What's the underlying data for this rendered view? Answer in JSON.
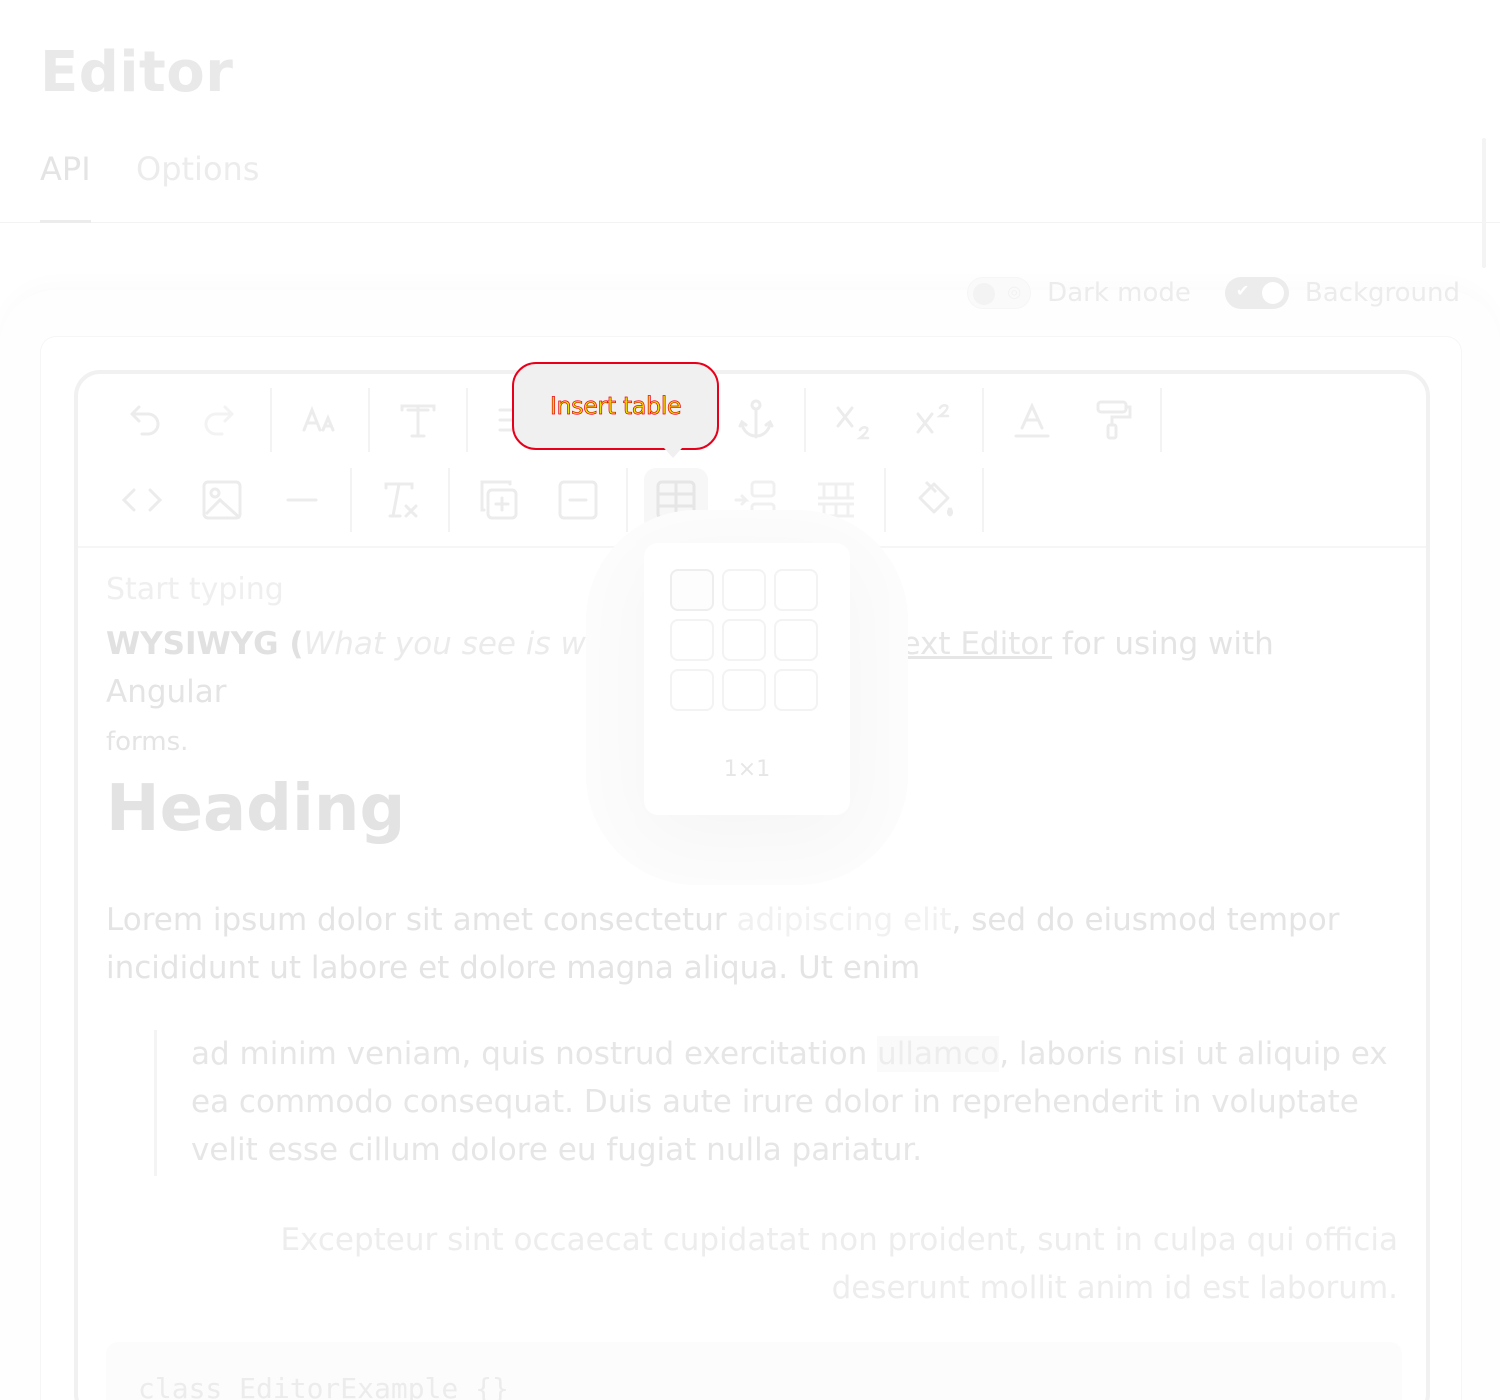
{
  "header": {
    "title": "Editor"
  },
  "tabs": [
    {
      "label": "API",
      "active": true
    },
    {
      "label": "Options",
      "active": false
    }
  ],
  "toggles": {
    "dark_mode": {
      "label": "Dark mode",
      "on": false
    },
    "background": {
      "label": "Background",
      "on": true
    }
  },
  "toolbar": {
    "row1": [
      "undo-icon",
      "redo-icon",
      "font-size-icon",
      "text-style-icon",
      "align-icon",
      "link-icon",
      "anchor-icon",
      "subscript-icon",
      "superscript-icon",
      "text-color-icon",
      "paint-roller-icon"
    ],
    "row2": [
      "code-icon",
      "image-icon",
      "horizontal-rule-icon",
      "clear-format-icon",
      "merge-cells-icon",
      "remove-cells-icon",
      "insert-table-icon",
      "insert-row-icon",
      "insert-column-icon",
      "cell-color-icon"
    ],
    "tooltip": "Insert table"
  },
  "table_picker": {
    "size_label": "1×1",
    "rows": 3,
    "cols": 3,
    "selected_rows": 1,
    "selected_cols": 1
  },
  "content": {
    "placeholder": "Start typing",
    "intro_bold": "WYSIWYG",
    "intro_open": " (",
    "intro_italic": "What you see is what yo",
    "intro_link": "Text Editor",
    "intro_rest": " for using with Angular",
    "intro_tail": "forms.",
    "heading": "Heading",
    "para_start": "Lorem ipsum dolor sit amet consectetur ",
    "para_highlight": "adipiscing elit",
    "para_end": ", sed do eiusmod tempor incididunt ut labore et dolore magna aliqua. Ut enim",
    "quote_start": "ad minim veniam, quis nostrud exercitation ",
    "quote_mark": "ullamco",
    "quote_end": ", laboris nisi ut aliquip ex ea commodo consequat. Duis aute irure dolor in reprehenderit in voluptate velit esse cillum dolore eu fugiat nulla pariatur.",
    "right_para": "Excepteur sint occaecat cupidatat non proident, sunt in culpa qui officia deserunt mollit anim id est laborum.",
    "code": "class EditorExample {}"
  }
}
